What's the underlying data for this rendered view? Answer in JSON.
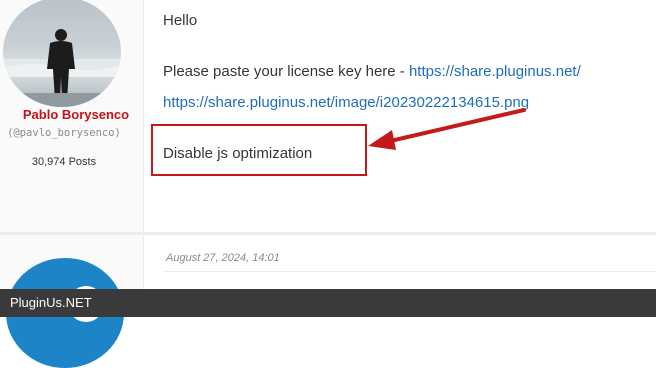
{
  "author": {
    "name": "Pablo Borysenco",
    "handle": "(@pavlo_borysenco)",
    "posts": "30,974 Posts"
  },
  "post": {
    "greeting": "Hello",
    "license_text": "Please paste your license key here - ",
    "license_link": "https://share.pluginus.net/",
    "image_link": "https://share.pluginus.net/image/i20230222134615.png",
    "instruction": "Disable js optimization"
  },
  "next_post": {
    "date": "August 27, 2024, 14:01"
  },
  "footer": {
    "brand": "PluginUs.NET"
  },
  "colors": {
    "author_name": "#c4121a",
    "link": "#1f6ebd",
    "annotation": "#c41a1a",
    "footer_bg": "#3a3a3a"
  }
}
